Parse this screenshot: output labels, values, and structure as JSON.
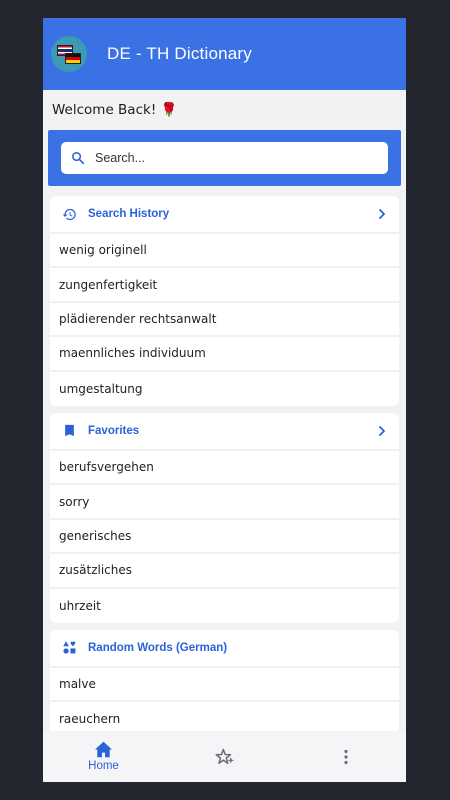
{
  "app": {
    "title": "DE - TH Dictionary",
    "logo_icon": "thai-german-flags-logo"
  },
  "welcome_text": "Welcome Back! 🌹",
  "search": {
    "placeholder": "Search...",
    "value": ""
  },
  "sections": {
    "history": {
      "title": "Search History",
      "icon": "history-icon",
      "items": [
        "wenig originell",
        "zungenfertigkeit",
        "plädierender rechtsanwalt",
        "maennliches individuum",
        "umgestaltung"
      ]
    },
    "favorites": {
      "title": "Favorites",
      "icon": "bookmark-icon",
      "items": [
        "berufsvergehen",
        "sorry",
        "generisches",
        "zusätzliches",
        "uhrzeit"
      ]
    },
    "random": {
      "title": "Random Words (German)",
      "icon": "shapes-icon",
      "items": [
        "malve",
        "raeuchern"
      ]
    }
  },
  "bottom_nav": {
    "home_label": "Home",
    "items": [
      "home-icon",
      "sparkle-star-icon",
      "more-vert-icon"
    ]
  },
  "colors": {
    "primary": "#3a72e6",
    "accent_text": "#2a63d6",
    "background": "#f2f2f5",
    "outer": "#23262f"
  }
}
